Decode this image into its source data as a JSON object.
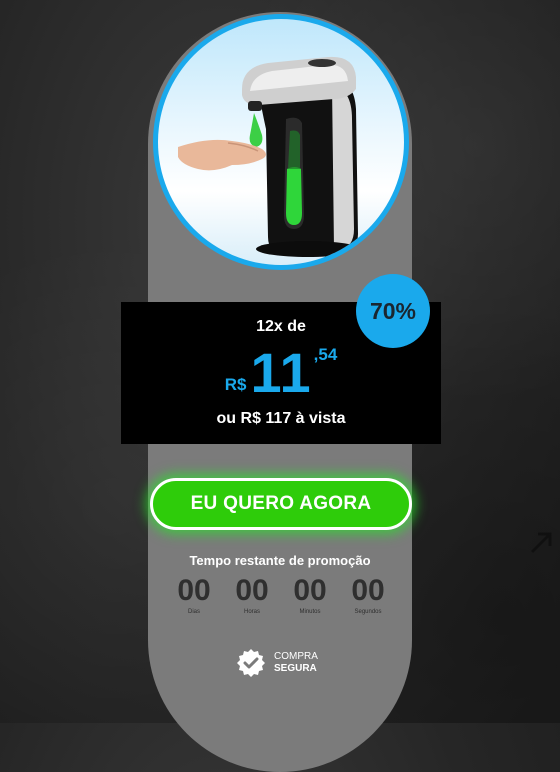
{
  "product": {
    "image_name": "automatic-soap-dispenser-image",
    "accent_color": "#1aa9ec"
  },
  "discount": {
    "label": "70%"
  },
  "price": {
    "installments": "12x de",
    "currency": "R$",
    "integer": "11",
    "cents": ",54",
    "cash": "ou R$ 117 à vista"
  },
  "cta": {
    "label": "EU QUERO AGORA",
    "color": "#2ecc0a"
  },
  "timer": {
    "title": "Tempo restante de promoção",
    "units": [
      {
        "value": "00",
        "label": "Dias"
      },
      {
        "value": "00",
        "label": "Horas"
      },
      {
        "value": "00",
        "label": "Minutos"
      },
      {
        "value": "00",
        "label": "Segundos"
      }
    ]
  },
  "secure": {
    "line1": "COMPRA",
    "line2": "SEGURA",
    "icon": "shield-check-icon"
  }
}
